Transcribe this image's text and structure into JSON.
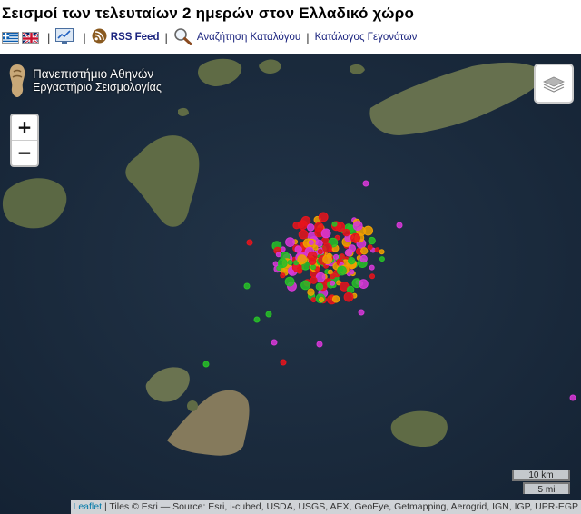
{
  "title": "Σεισμοί των τελευταίων 2 ημερών στον Ελλαδικό χώρο",
  "toolbar": {
    "separator": "|",
    "rss_label": "RSS Feed",
    "search_label": "Αναζήτηση Καταλόγου",
    "catalog_label": "Κατάλογος Γεγονότων"
  },
  "logo": {
    "line1": "Πανεπιστήμιο Αθηνών",
    "line2": "Εργαστήριο Σεισμολογίας"
  },
  "zoom": {
    "in_label": "+",
    "out_label": "−"
  },
  "scale": {
    "km_label": "10 km",
    "mi_label": "5 mi"
  },
  "attribution": {
    "leaflet": "Leaflet",
    "tiles": " | Tiles © Esri — Source: Esri, i-cubed, USDA, USGS, AEX, GeoEye, Getmapping, Aerogrid, IGN, IGP, UPR-EGP"
  },
  "colors": {
    "sea": "#1b2b3d",
    "land": "#5d6b48",
    "quake_red": "#e8141c",
    "quake_orange": "#f0a000",
    "quake_green": "#28c028",
    "quake_magenta": "#d838d8",
    "link": "#1a237e"
  },
  "icons": [
    "greek-flag-icon",
    "uk-flag-icon",
    "chart-icon",
    "rss-icon",
    "magnifier-icon",
    "layers-icon",
    "university-logo-icon"
  ]
}
